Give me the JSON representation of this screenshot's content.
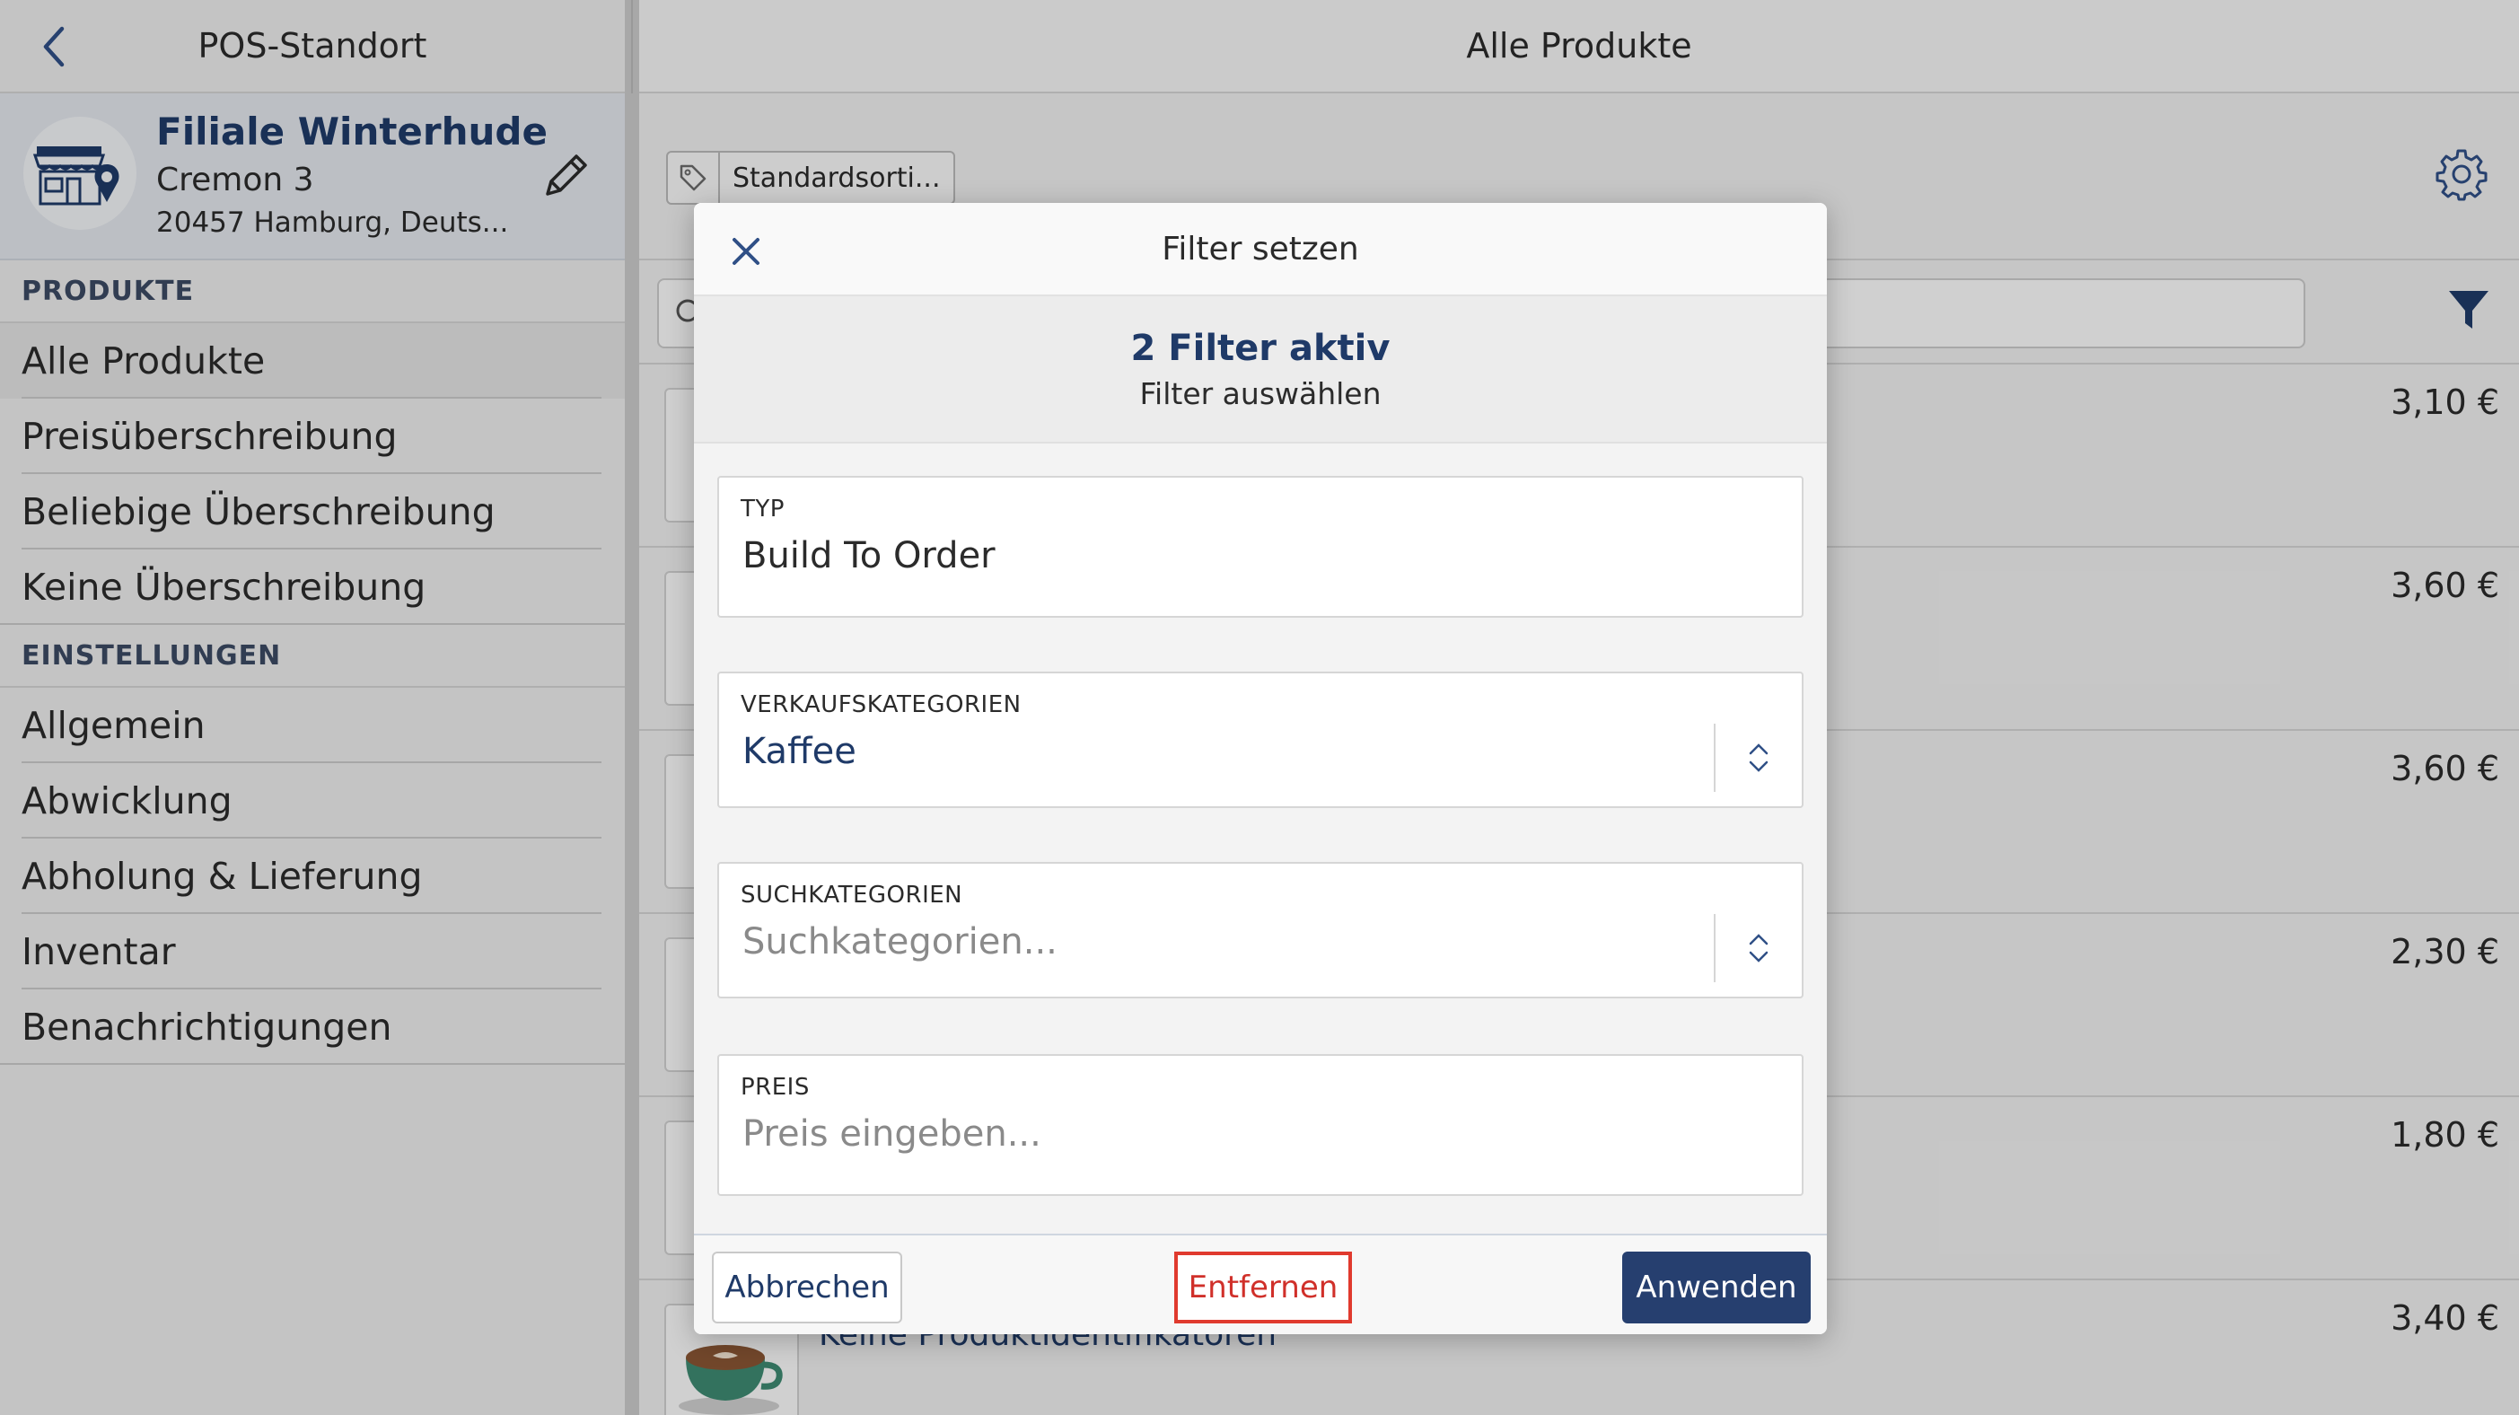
{
  "sidebar": {
    "header_title": "POS-Standort",
    "store": {
      "name": "Filiale Winterhude",
      "street": "Cremon 3",
      "city": "20457 Hamburg, Deuts..."
    },
    "sections": [
      {
        "title": "PRODUKTE",
        "items": [
          "Alle Produkte",
          "Preisüberschreibung",
          "Beliebige Überschreibung",
          "Keine Überschreibung"
        ]
      },
      {
        "title": "EINSTELLUNGEN",
        "items": [
          "Allgemein",
          "Abwicklung",
          "Abholung & Lieferung",
          "Inventar",
          "Benachrichtigungen"
        ]
      }
    ],
    "active_item": "Alle Produkte"
  },
  "main": {
    "title": "Alle Produkte",
    "tag_chip": "Standardsorti...",
    "products": [
      {
        "price": "3,10 €",
        "name": ""
      },
      {
        "price": "3,60 €",
        "name": ""
      },
      {
        "price": "3,60 €",
        "name": ""
      },
      {
        "price": "2,30 €",
        "name": ""
      },
      {
        "price": "1,80 €",
        "name": ""
      },
      {
        "price": "3,40 €",
        "name": "Keine Produktidentifikatoren"
      }
    ]
  },
  "modal": {
    "title": "Filter setzen",
    "summary_count": "2 Filter aktiv",
    "summary_sub": "Filter auswählen",
    "fields": {
      "typ": {
        "label": "TYP",
        "value": "Build To Order"
      },
      "verkauf": {
        "label": "VERKAUFSKATEGORIEN",
        "value": "Kaffee"
      },
      "such": {
        "label": "SUCHKATEGORIEN",
        "placeholder": "Suchkategorien..."
      },
      "preis": {
        "label": "PREIS",
        "placeholder": "Preis eingeben..."
      }
    },
    "buttons": {
      "cancel": "Abbrechen",
      "remove": "Entfernen",
      "apply": "Anwenden"
    }
  },
  "colors": {
    "accent_navy": "#1f3a68",
    "apply_button": "#263f6f",
    "remove_highlight": "#e03a2e"
  }
}
